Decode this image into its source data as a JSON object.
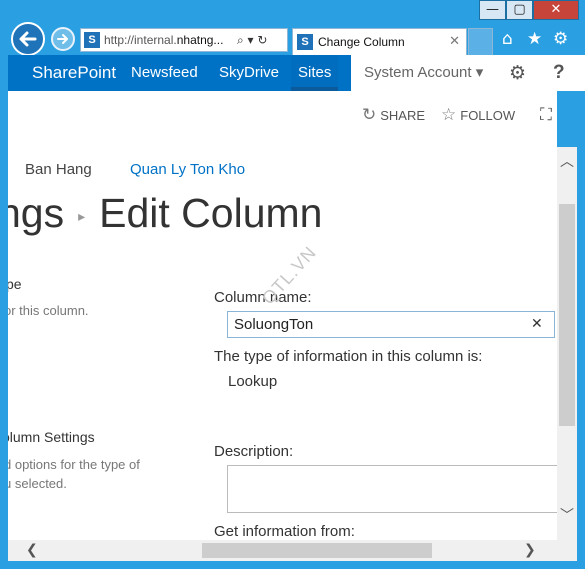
{
  "window": {
    "min_glyph": "—",
    "max_glyph": "▢",
    "close_glyph": "✕"
  },
  "browser": {
    "address_prefix": "http://internal.",
    "address_host": "nhatng...",
    "address_icons": "⌕ ▾ ↻",
    "site_icon_letter": "S",
    "tab_title": "Change Column",
    "tab_close": "✕",
    "toolbar_icons": {
      "home": "⌂",
      "favorites": "★",
      "tools": "⚙"
    }
  },
  "suitebar": {
    "brand": "SharePoint",
    "nav": [
      "Newsfeed",
      "SkyDrive",
      "Sites"
    ],
    "account": "System Account ▾",
    "settings_glyph": "⚙",
    "help_glyph": "?"
  },
  "actions": {
    "share_icon": "↻",
    "share": "SHARE",
    "follow_icon": "☆",
    "follow": "FOLLOW",
    "focus_icon": "⛶"
  },
  "breadcrumb": {
    "item1": "Ban Hang",
    "item2": "Quan Ly Ton Kho"
  },
  "page": {
    "title_prefix": "ngs",
    "title_sep": "▸",
    "title": "Edit Column"
  },
  "left_panel": {
    "section1_heading": "pe",
    "section1_desc": "or this column.",
    "section2_heading": "olumn Settings",
    "section2_desc_line1": "d options for the type of",
    "section2_desc_line2": "u selected."
  },
  "form": {
    "column_name_label": "Column name:",
    "column_name_value": "SoluongTon",
    "clear_glyph": "✕",
    "type_label": "The type of information in this column is:",
    "type_value": "Lookup",
    "description_label": "Description:",
    "description_value": "",
    "get_info_label": "Get information from:"
  },
  "watermark": "QTL.VN",
  "scrollbars": {
    "up": "︿",
    "down": "﹀",
    "left": "❮",
    "right": "❯"
  }
}
